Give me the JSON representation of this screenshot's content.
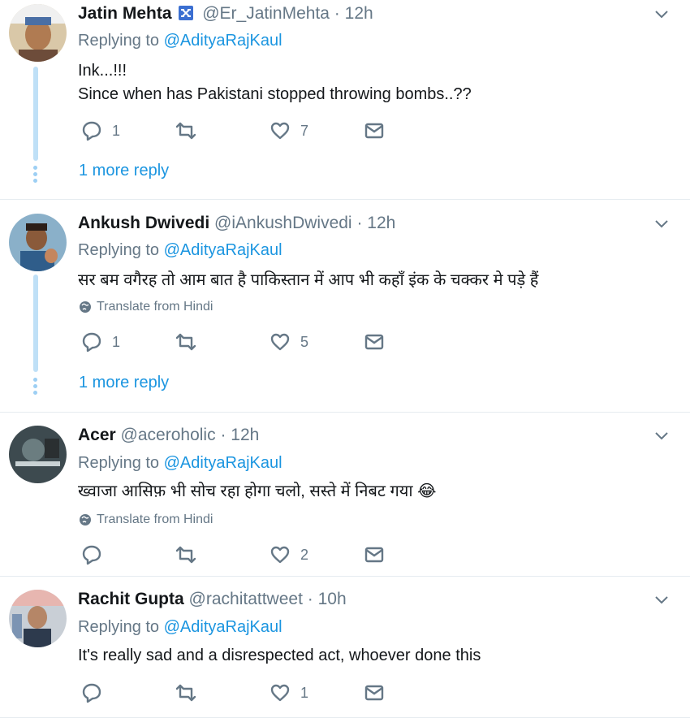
{
  "tweets": [
    {
      "name": "Jatin Mehta",
      "handle": "@Er_JatinMehta",
      "sep": "·",
      "time": "12h",
      "replying_prefix": "Replying to ",
      "replying_to": "@AdityaRajKaul",
      "lines": [
        "Ink...!!!",
        "Since when has Pakistani stopped throwing bombs..??"
      ],
      "translate": "",
      "replies": "1",
      "retweets": "",
      "likes": "7",
      "more_reply": "1 more reply",
      "verified": true
    },
    {
      "name": "Ankush Dwivedi",
      "handle": "@iAnkushDwivedi",
      "sep": "·",
      "time": "12h",
      "replying_prefix": "Replying to ",
      "replying_to": "@AdityaRajKaul",
      "lines": [
        "सर बम वगैरह तो आम बात है पाकिस्तान में आप भी कहाँ इंक के चक्कर मे पड़े हैं"
      ],
      "translate": "Translate from Hindi",
      "replies": "1",
      "retweets": "",
      "likes": "5",
      "more_reply": "1 more reply",
      "verified": false
    },
    {
      "name": "Acer",
      "handle": "@aceroholic",
      "sep": "·",
      "time": "12h",
      "replying_prefix": "Replying to ",
      "replying_to": "@AdityaRajKaul",
      "lines": [
        "ख्वाजा आसिफ़ भी सोच रहा होगा चलो, सस्ते में निबट गया 😂"
      ],
      "translate": "Translate from Hindi",
      "replies": "",
      "retweets": "",
      "likes": "2",
      "more_reply": "",
      "verified": false
    },
    {
      "name": "Rachit Gupta",
      "handle": "@rachitattweet",
      "sep": "·",
      "time": "10h",
      "replying_prefix": "Replying to ",
      "replying_to": "@AdityaRajKaul",
      "lines": [
        "It's really sad and a disrespected act, whoever done this"
      ],
      "translate": "",
      "replies": "",
      "retweets": "",
      "likes": "1",
      "more_reply": "",
      "verified": false
    }
  ],
  "icons": {
    "reply": "reply-icon",
    "retweet": "retweet-icon",
    "like": "heart-icon",
    "dm": "envelope-icon",
    "caret": "chevron-down-icon",
    "verified": "verified-badge-icon",
    "globe": "globe-icon"
  },
  "colors": {
    "link": "#1b95e0",
    "muted": "#657786",
    "text": "#14171a",
    "thread": "#bfe0f7",
    "divider": "#e6ecf0"
  }
}
